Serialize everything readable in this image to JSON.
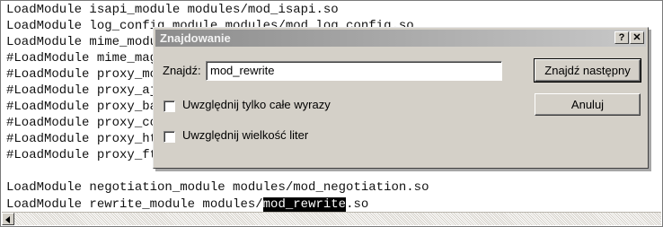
{
  "editor": {
    "lines": [
      {
        "text": "LoadModule isapi_module modules/mod_isapi.so"
      },
      {
        "text": "LoadModule log_config_module modules/mod_log_config.so"
      },
      {
        "text": "LoadModule mime_module modules/mod_mime.so"
      },
      {
        "text": "#LoadModule mime_magic_module modules/mod_mime_magic.so"
      },
      {
        "text": "#LoadModule proxy_module modules/mod_proxy.so"
      },
      {
        "text": "#LoadModule proxy_ajp_module modules/mod_proxy_ajp.so"
      },
      {
        "text": "#LoadModule proxy_balancer_module modules/mod_proxy_balancer.so"
      },
      {
        "text": "#LoadModule proxy_connect_module modules/mod_proxy_connect.so"
      },
      {
        "text": "#LoadModule proxy_http_module modules/mod_proxy_http.so"
      },
      {
        "text": "#LoadModule proxy_ftp_module modules/mod_proxy_ftp.so"
      },
      {
        "text": "LoadModule negotiation_module modules/mod_negotiation.so"
      },
      {
        "prefix": "LoadModule rewrite_module modules/",
        "highlight": "mod_rewrite",
        "suffix": ".so"
      }
    ]
  },
  "dialog": {
    "title": "Znajdowanie",
    "help_label": "?",
    "close_label": "✕",
    "find_label": "Znajdź:",
    "find_value": "mod_rewrite",
    "find_next_label": "Znajdź następny",
    "cancel_label": "Anuluj",
    "whole_words_label": "Uwzględnij tylko całe wyrazy",
    "match_case_label": "Uwzględnij wielkość liter",
    "whole_words_checked": false,
    "match_case_checked": false
  }
}
